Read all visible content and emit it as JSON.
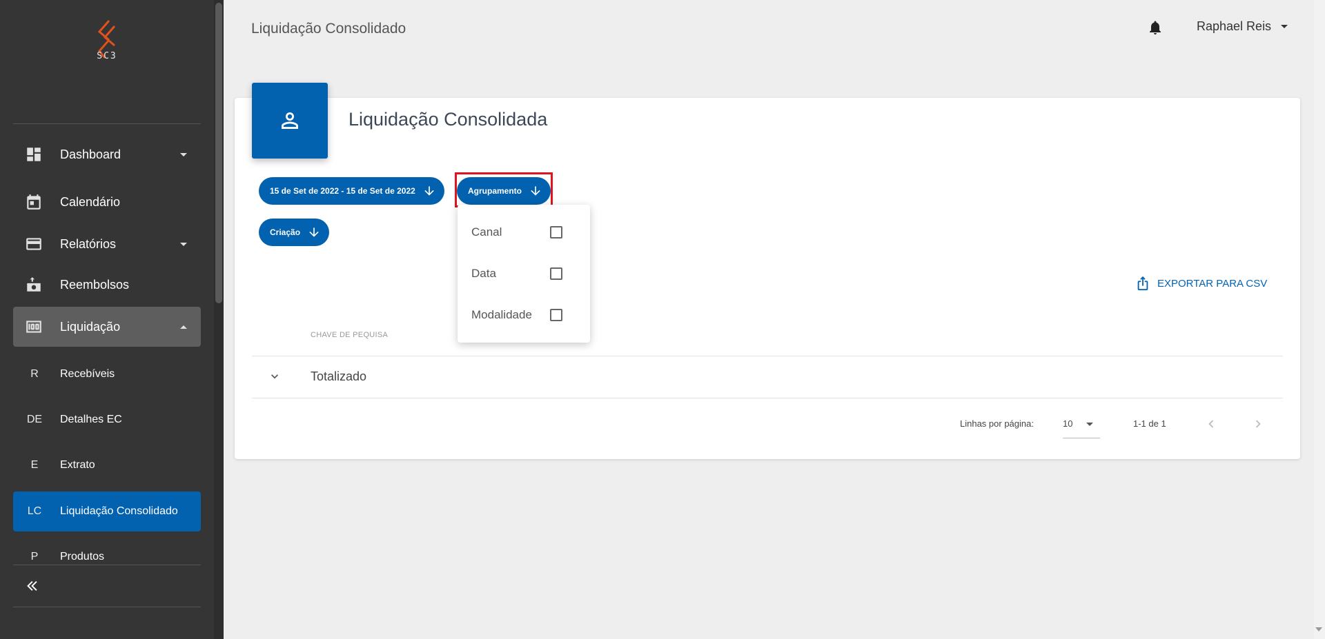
{
  "header": {
    "title": "Liquidação Consolidado",
    "user_name": "Raphael Reis"
  },
  "sidebar": {
    "logo_text": "SC3",
    "items": [
      {
        "label": "Dashboard",
        "icon": "dashboard-icon",
        "has_caret": true
      },
      {
        "label": "Calendário",
        "icon": "calendar-icon"
      },
      {
        "label": "Relatórios",
        "icon": "credit-card-icon",
        "has_caret": true
      },
      {
        "label": "Reembolsos",
        "icon": "money-refund-icon"
      },
      {
        "label": "Liquidação",
        "icon": "money-icon",
        "expanded": true
      }
    ],
    "sub_items": [
      {
        "abbr": "R",
        "label": "Recebíveis"
      },
      {
        "abbr": "DE",
        "label": "Detalhes EC"
      },
      {
        "abbr": "E",
        "label": "Extrato"
      },
      {
        "abbr": "LC",
        "label": "Liquidação Consolidado",
        "active": true
      },
      {
        "abbr": "P",
        "label": "Produtos"
      }
    ]
  },
  "card": {
    "title": "Liquidação Consolidada",
    "filters": {
      "date_range": "15 de Set de 2022 - 15 de Set de 2022",
      "grouping": "Agrupamento",
      "creation": "Criação"
    },
    "export_label": "EXPORTAR PARA CSV",
    "table": {
      "column_header": "CHAVE DE PEQUISA",
      "rows": [
        {
          "label": "Totalizado"
        }
      ]
    },
    "pagination": {
      "rows_label": "Linhas por página:",
      "rows_value": "10",
      "range": "1-1 de 1"
    }
  },
  "grouping_menu": {
    "options": [
      {
        "label": "Canal",
        "checked": false
      },
      {
        "label": "Data",
        "checked": false
      },
      {
        "label": "Modalidade",
        "checked": false
      }
    ]
  },
  "colors": {
    "primary": "#0262b0",
    "sidebar_bg": "#353535",
    "highlight": "#e0141e"
  }
}
